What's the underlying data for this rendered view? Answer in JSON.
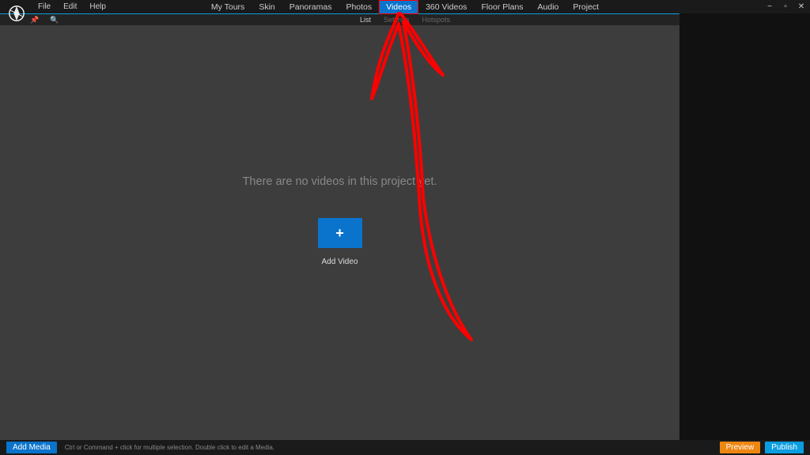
{
  "menu": {
    "file": "File",
    "edit": "Edit",
    "help": "Help"
  },
  "mainTabs": {
    "myTours": "My Tours",
    "skin": "Skin",
    "panoramas": "Panoramas",
    "photos": "Photos",
    "videos": "Videos",
    "videos360": "360 Videos",
    "floorPlans": "Floor Plans",
    "audio": "Audio",
    "project": "Project"
  },
  "subTabs": {
    "list": "List",
    "settings": "Settings",
    "hotspots": "Hotspots"
  },
  "content": {
    "emptyMessage": "There are no videos in this project yet.",
    "addVideoLabel": "Add Video"
  },
  "footer": {
    "addMedia": "Add Media",
    "hint": "Ctrl or Command + click for multiple selection. Double click to edit a Media.",
    "preview": "Preview",
    "publish": "Publish"
  },
  "colors": {
    "primary": "#0a73cc",
    "accent": "#0a9de0",
    "orange": "#ed8712",
    "annotation": "#ff0000"
  }
}
